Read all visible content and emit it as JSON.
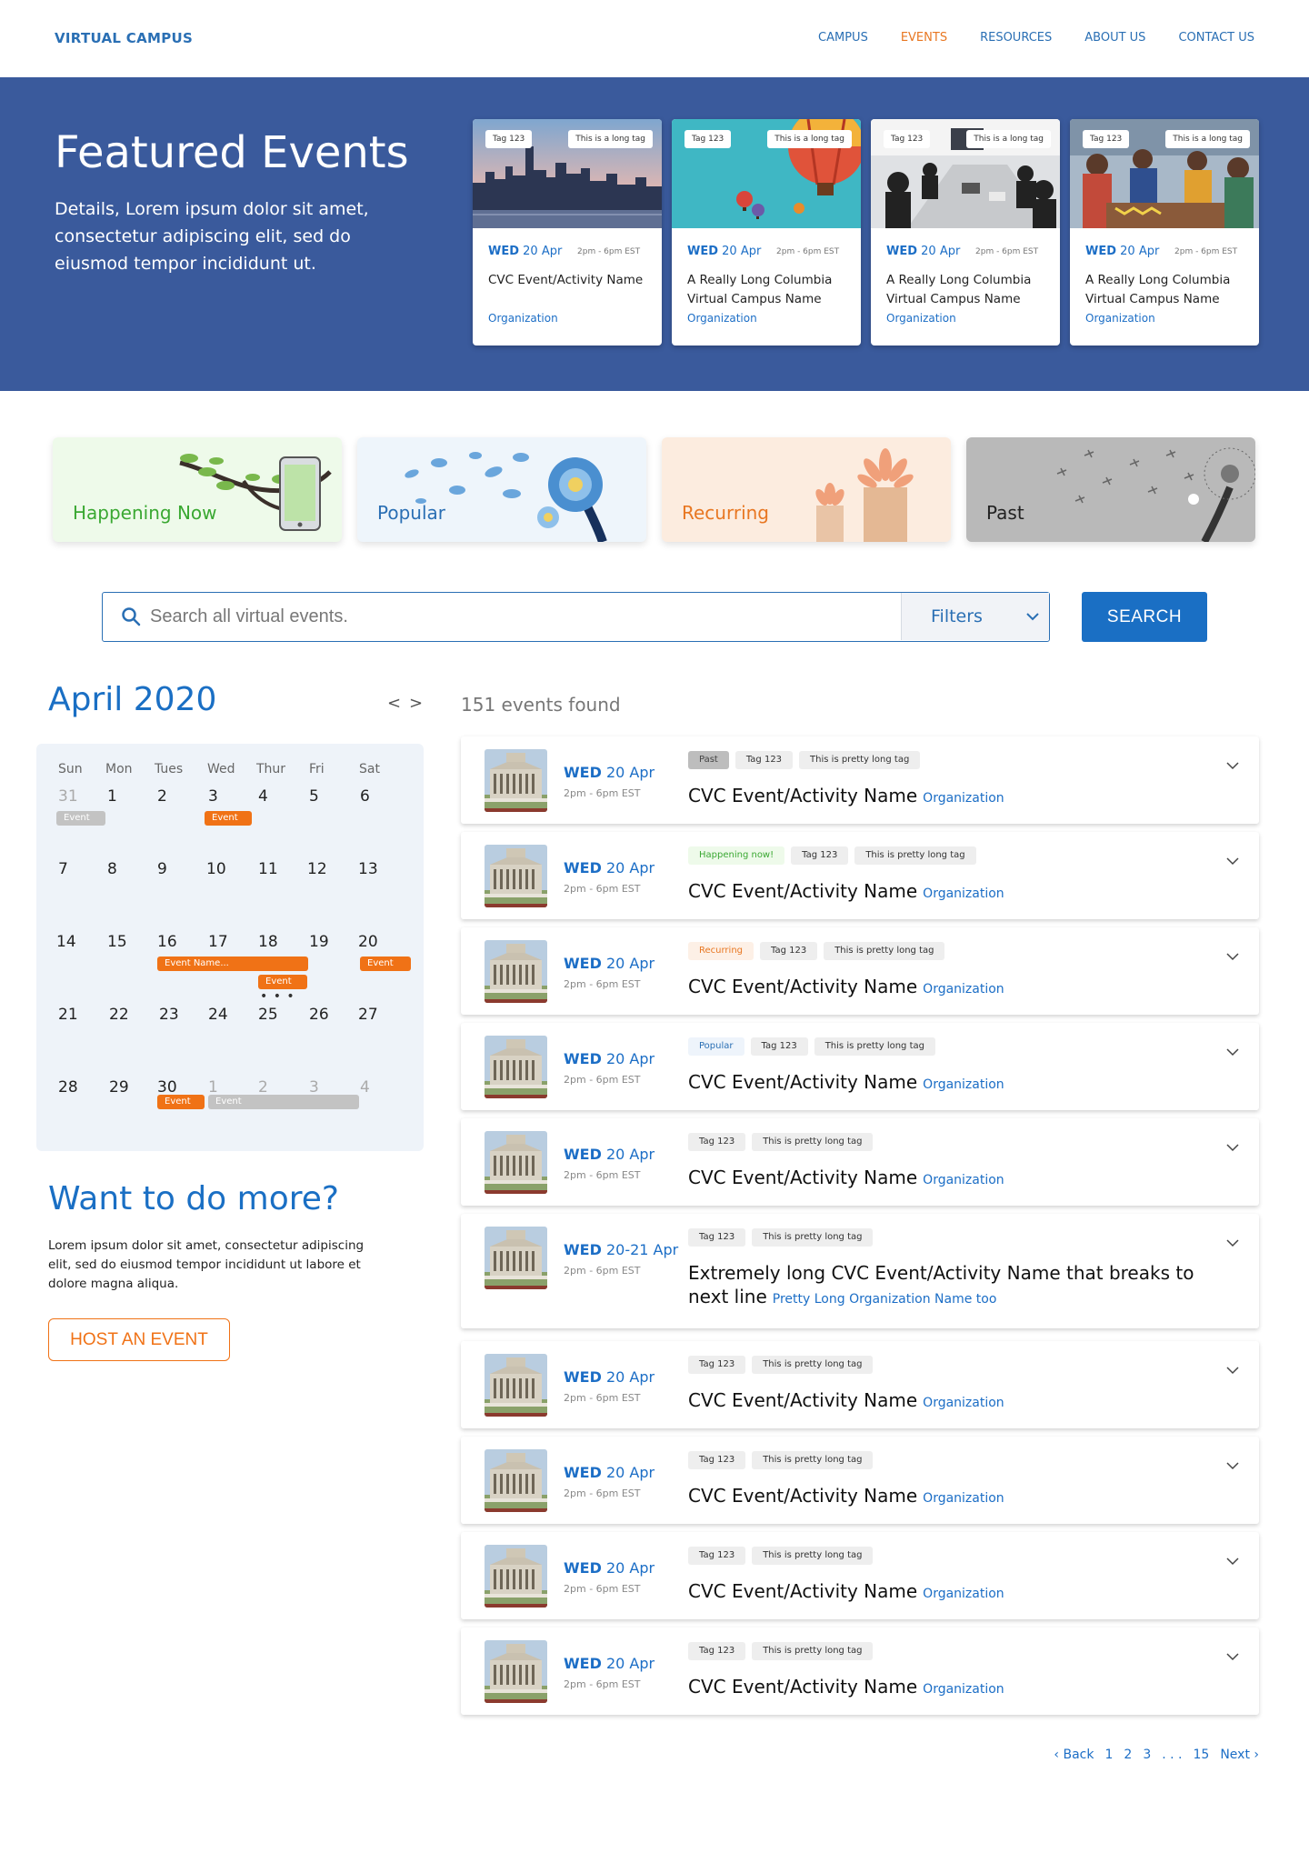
{
  "header": {
    "logo": "VIRTUAL CAMPUS",
    "nav": [
      "CAMPUS",
      "EVENTS",
      "RESOURCES",
      "ABOUT US",
      "CONTACT US"
    ],
    "active_color": "#e87722",
    "link_color": "#2a6fb4"
  },
  "hero": {
    "title": "Featured Events",
    "description": "Details, Lorem ipsum dolor sit amet, consectetur adipiscing elit, sed do eiusmod tempor incididunt ut.",
    "background": "#3a5a9c",
    "cards": [
      {
        "tag1": "Tag 123",
        "tag2": "This is a long tag",
        "day": "WED",
        "date": "20 Apr",
        "time": "2pm - 6pm EST",
        "name": "CVC Event/Activity Name",
        "org": "Organization"
      },
      {
        "tag1": "Tag 123",
        "tag2": "This is a long tag",
        "day": "WED",
        "date": "20 Apr",
        "time": "2pm - 6pm EST",
        "name": "A Really Long Columbia Virtual Campus Name",
        "org": "Organization"
      },
      {
        "tag1": "Tag 123",
        "tag2": "This is a long tag",
        "day": "WED",
        "date": "20 Apr",
        "time": "2pm - 6pm EST",
        "name": "A Really Long Columbia Virtual Campus Name",
        "org": "Organization"
      },
      {
        "tag1": "Tag 123",
        "tag2": "This is a long tag",
        "day": "WED",
        "date": "20 Apr",
        "time": "2pm - 6pm EST",
        "name": "A Really Long Columbia Virtual Campus Name",
        "org": "Organization"
      }
    ]
  },
  "categories": [
    {
      "label": "Happening Now",
      "color": "#3aa832",
      "bg": "#eefaea"
    },
    {
      "label": "Popular",
      "color": "#2a6fb4",
      "bg": "#eef5fb"
    },
    {
      "label": "Recurring",
      "color": "#e87722",
      "bg": "#fcecdf"
    },
    {
      "label": "Past",
      "color": "#222222",
      "bg": "#b9b9b9"
    }
  ],
  "search": {
    "placeholder": "Search all virtual events.",
    "filters_label": "Filters",
    "button_label": "SEARCH"
  },
  "calendar": {
    "title": "April 2020",
    "prev": "<",
    "next": ">",
    "weekdays": [
      "Sun",
      "Mon",
      "Tues",
      "Wed",
      "Thur",
      "Fri",
      "Sat"
    ],
    "weeks": [
      [
        "31",
        "1",
        "2",
        "3",
        "4",
        "5",
        "6"
      ],
      [
        "7",
        "8",
        "9",
        "10",
        "11",
        "12",
        "13"
      ],
      [
        "14",
        "15",
        "16",
        "17",
        "18",
        "19",
        "20"
      ],
      [
        "21",
        "22",
        "23",
        "24",
        "25",
        "26",
        "27"
      ],
      [
        "28",
        "29",
        "30",
        "1",
        "2",
        "3",
        "4"
      ]
    ],
    "events": {
      "mar31": "Event",
      "apr3": "Event",
      "apr16": "Event Name...",
      "apr18": "Event",
      "apr20": "Event",
      "apr30": "Event",
      "may1": "Event",
      "more": "• • •"
    }
  },
  "more": {
    "title": "Want to do more?",
    "text": "Lorem ipsum dolor sit amet, consectetur adipiscing elit, sed do eiusmod tempor incididunt ut labore et dolore magna aliqua.",
    "button": "HOST AN EVENT"
  },
  "events": {
    "count": "151 events found",
    "items": [
      {
        "day": "WED",
        "date": "20 Apr",
        "time": "2pm - 6pm EST",
        "tags": [
          {
            "label": "Past",
            "kind": "past"
          },
          {
            "label": "Tag 123",
            "kind": ""
          },
          {
            "label": "This is pretty long tag",
            "kind": ""
          }
        ],
        "title": "CVC Event/Activity Name",
        "org": "Organization"
      },
      {
        "day": "WED",
        "date": "20 Apr",
        "time": "2pm - 6pm EST",
        "tags": [
          {
            "label": "Happening now!",
            "kind": "now"
          },
          {
            "label": "Tag 123",
            "kind": ""
          },
          {
            "label": "This is pretty long tag",
            "kind": ""
          }
        ],
        "title": "CVC Event/Activity Name",
        "org": "Organization"
      },
      {
        "day": "WED",
        "date": "20 Apr",
        "time": "2pm - 6pm EST",
        "tags": [
          {
            "label": "Recurring",
            "kind": "recur"
          },
          {
            "label": "Tag 123",
            "kind": ""
          },
          {
            "label": "This is pretty long tag",
            "kind": ""
          }
        ],
        "title": "CVC Event/Activity Name",
        "org": "Organization"
      },
      {
        "day": "WED",
        "date": "20 Apr",
        "time": "2pm - 6pm EST",
        "tags": [
          {
            "label": "Popular",
            "kind": "pop"
          },
          {
            "label": "Tag 123",
            "kind": ""
          },
          {
            "label": "This is pretty long tag",
            "kind": ""
          }
        ],
        "title": "CVC Event/Activity Name",
        "org": "Organization"
      },
      {
        "day": "WED",
        "date": "20 Apr",
        "time": "2pm - 6pm EST",
        "tags": [
          {
            "label": "Tag 123",
            "kind": ""
          },
          {
            "label": "This is pretty long tag",
            "kind": ""
          }
        ],
        "title": "CVC Event/Activity Name",
        "org": "Organization"
      },
      {
        "day": "WED",
        "date": "20-21 Apr",
        "time": "2pm - 6pm EST",
        "tags": [
          {
            "label": "Tag 123",
            "kind": ""
          },
          {
            "label": "This is pretty long tag",
            "kind": ""
          }
        ],
        "title": "Extremely long CVC Event/Activity Name that breaks to next line",
        "org": "Pretty Long Organization Name too"
      },
      {
        "day": "WED",
        "date": "20 Apr",
        "time": "2pm - 6pm EST",
        "tags": [
          {
            "label": "Tag 123",
            "kind": ""
          },
          {
            "label": "This is pretty long tag",
            "kind": ""
          }
        ],
        "title": "CVC Event/Activity Name",
        "org": "Organization"
      },
      {
        "day": "WED",
        "date": "20 Apr",
        "time": "2pm - 6pm EST",
        "tags": [
          {
            "label": "Tag 123",
            "kind": ""
          },
          {
            "label": "This is pretty long tag",
            "kind": ""
          }
        ],
        "title": "CVC Event/Activity Name",
        "org": "Organization"
      },
      {
        "day": "WED",
        "date": "20 Apr",
        "time": "2pm - 6pm EST",
        "tags": [
          {
            "label": "Tag 123",
            "kind": ""
          },
          {
            "label": "This is pretty long tag",
            "kind": ""
          }
        ],
        "title": "CVC Event/Activity Name",
        "org": "Organization"
      },
      {
        "day": "WED",
        "date": "20 Apr",
        "time": "2pm - 6pm EST",
        "tags": [
          {
            "label": "Tag 123",
            "kind": ""
          },
          {
            "label": "This is pretty long tag",
            "kind": ""
          }
        ],
        "title": "CVC Event/Activity Name",
        "org": "Organization"
      }
    ]
  },
  "pagination": {
    "back": "‹ Back",
    "pages": [
      "1",
      "2",
      "3"
    ],
    "ellipsis": ". . .",
    "last": "15",
    "next": "Next ›"
  }
}
